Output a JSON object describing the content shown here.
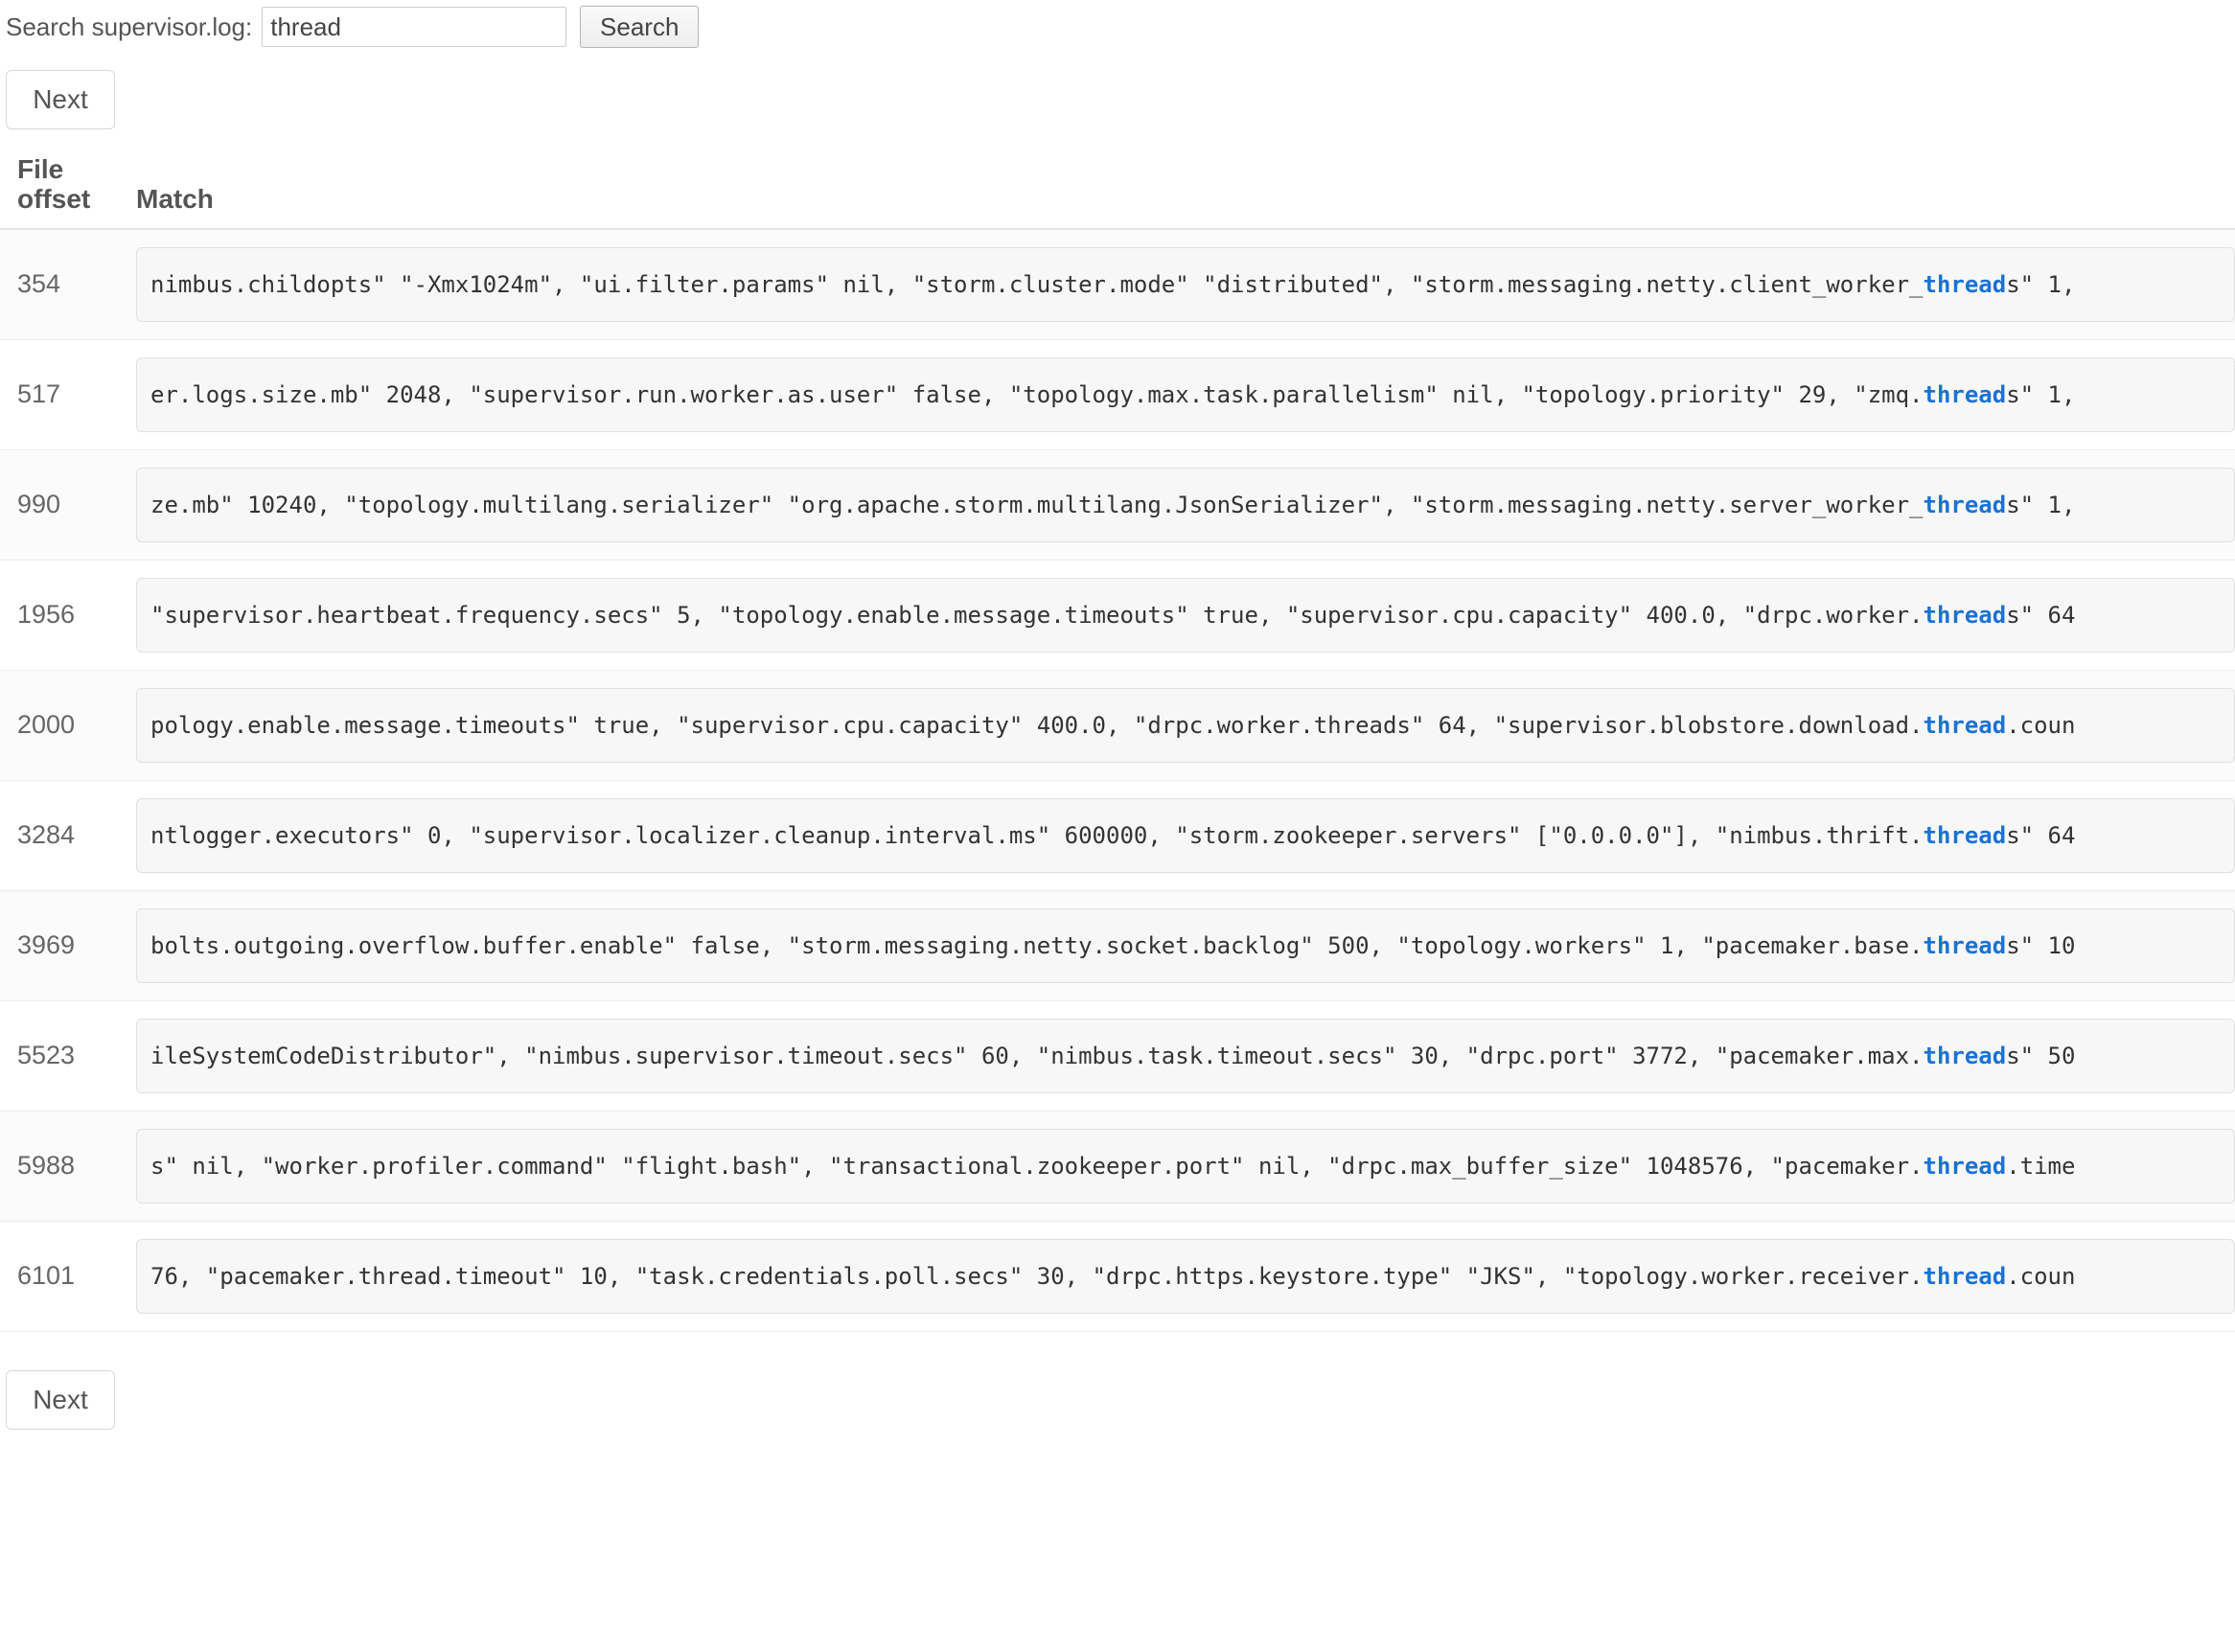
{
  "search": {
    "label": "Search supervisor.log:",
    "value": "thread",
    "placeholder": "",
    "button_label": "Search"
  },
  "pagination": {
    "next_top_label": "Next",
    "next_bottom_label": "Next"
  },
  "table": {
    "headers": {
      "offset": "File offset",
      "match": "Match"
    },
    "rows": [
      {
        "offset": "354",
        "pre": "nimbus.childopts\" \"-Xmx1024m\", \"ui.filter.params\" nil, \"storm.cluster.mode\" \"distributed\", \"storm.messaging.netty.client_worker_",
        "hl": "thread",
        "post": "s\" 1,"
      },
      {
        "offset": "517",
        "pre": "er.logs.size.mb\" 2048, \"supervisor.run.worker.as.user\" false, \"topology.max.task.parallelism\" nil, \"topology.priority\" 29, \"zmq.",
        "hl": "thread",
        "post": "s\" 1,"
      },
      {
        "offset": "990",
        "pre": "ze.mb\" 10240, \"topology.multilang.serializer\" \"org.apache.storm.multilang.JsonSerializer\", \"storm.messaging.netty.server_worker_",
        "hl": "thread",
        "post": "s\" 1,"
      },
      {
        "offset": "1956",
        "pre": "\"supervisor.heartbeat.frequency.secs\" 5, \"topology.enable.message.timeouts\" true, \"supervisor.cpu.capacity\" 400.0, \"drpc.worker.",
        "hl": "thread",
        "post": "s\" 64"
      },
      {
        "offset": "2000",
        "pre": "pology.enable.message.timeouts\" true, \"supervisor.cpu.capacity\" 400.0, \"drpc.worker.threads\" 64, \"supervisor.blobstore.download.",
        "hl": "thread",
        "post": ".coun"
      },
      {
        "offset": "3284",
        "pre": "ntlogger.executors\" 0, \"supervisor.localizer.cleanup.interval.ms\" 600000, \"storm.zookeeper.servers\" [\"0.0.0.0\"], \"nimbus.thrift.",
        "hl": "thread",
        "post": "s\" 64"
      },
      {
        "offset": "3969",
        "pre": "bolts.outgoing.overflow.buffer.enable\" false, \"storm.messaging.netty.socket.backlog\" 500, \"topology.workers\" 1, \"pacemaker.base.",
        "hl": "thread",
        "post": "s\" 10"
      },
      {
        "offset": "5523",
        "pre": "ileSystemCodeDistributor\", \"nimbus.supervisor.timeout.secs\" 60, \"nimbus.task.timeout.secs\" 30, \"drpc.port\" 3772, \"pacemaker.max.",
        "hl": "thread",
        "post": "s\" 50"
      },
      {
        "offset": "5988",
        "pre": "s\" nil, \"worker.profiler.command\" \"flight.bash\", \"transactional.zookeeper.port\" nil, \"drpc.max_buffer_size\" 1048576, \"pacemaker.",
        "hl": "thread",
        "post": ".time"
      },
      {
        "offset": "6101",
        "pre": "76, \"pacemaker.thread.timeout\" 10, \"task.credentials.poll.secs\" 30, \"drpc.https.keystore.type\" \"JKS\", \"topology.worker.receiver.",
        "hl": "thread",
        "post": ".coun"
      }
    ]
  },
  "colors": {
    "highlight": "#1a72d4",
    "text": "#555555",
    "match_bg": "#f7f7f7"
  }
}
